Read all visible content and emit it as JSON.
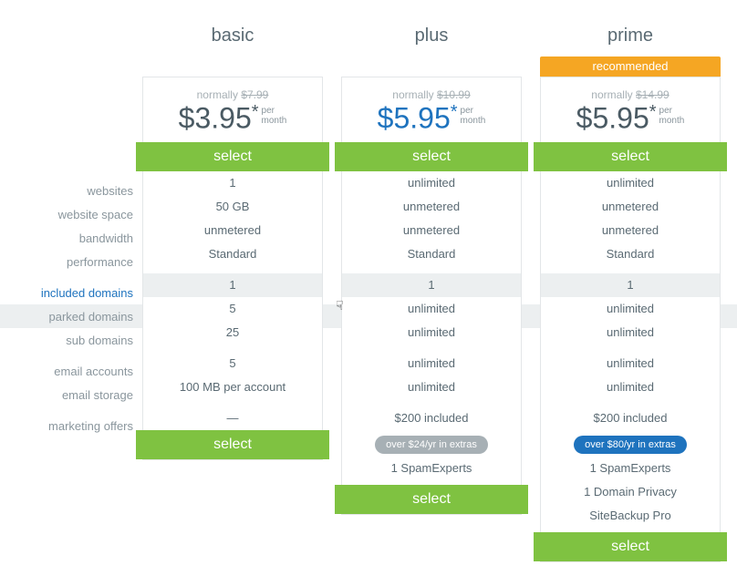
{
  "labels": {
    "websites": "websites",
    "website_space": "website space",
    "bandwidth": "bandwidth",
    "performance": "performance",
    "included_domains": "included domains",
    "parked_domains": "parked domains",
    "sub_domains": "sub domains",
    "email_accounts": "email accounts",
    "email_storage": "email storage",
    "marketing_offers": "marketing offers"
  },
  "common": {
    "normally_prefix": "normally",
    "per1": "per",
    "per2": "month",
    "select_label": "select",
    "recommended_label": "recommended"
  },
  "plans": {
    "basic": {
      "title": "basic",
      "old_price": "$7.99",
      "price": "$3.95",
      "star": "*",
      "price_color": "default",
      "features": {
        "websites": "1",
        "website_space": "50 GB",
        "bandwidth": "unmetered",
        "performance": "Standard",
        "included_domains": "1",
        "parked_domains": "5",
        "sub_domains": "25",
        "email_accounts": "5",
        "email_storage": "100 MB per account",
        "marketing_offers": "—"
      }
    },
    "plus": {
      "title": "plus",
      "old_price": "$10.99",
      "price": "$5.95",
      "star": "*",
      "price_color": "blue",
      "features": {
        "websites": "unlimited",
        "website_space": "unmetered",
        "bandwidth": "unmetered",
        "performance": "Standard",
        "included_domains": "1",
        "parked_domains": "unlimited",
        "sub_domains": "unlimited",
        "email_accounts": "unlimited",
        "email_storage": "unlimited",
        "marketing_offers": "$200 included"
      },
      "extras_pill": "over $24/yr in extras",
      "extras_pill_color": "grey",
      "extras_lines": [
        "1 SpamExperts"
      ]
    },
    "prime": {
      "title": "prime",
      "old_price": "$14.99",
      "price": "$5.95",
      "star": "*",
      "price_color": "default",
      "recommended": true,
      "features": {
        "websites": "unlimited",
        "website_space": "unmetered",
        "bandwidth": "unmetered",
        "performance": "Standard",
        "included_domains": "1",
        "parked_domains": "unlimited",
        "sub_domains": "unlimited",
        "email_accounts": "unlimited",
        "email_storage": "unlimited",
        "marketing_offers": "$200 included"
      },
      "extras_pill": "over $80/yr in extras",
      "extras_pill_color": "blue",
      "extras_lines": [
        "1 SpamExperts",
        "1 Domain Privacy",
        "SiteBackup Pro"
      ]
    }
  }
}
